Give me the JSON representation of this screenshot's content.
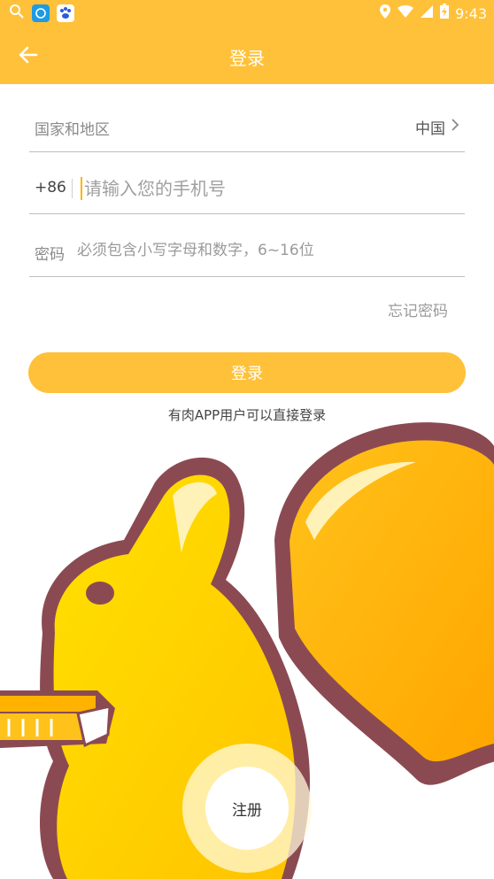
{
  "status_bar": {
    "time": "9:43"
  },
  "header": {
    "title": "登录",
    "back_icon": "arrow-left-icon"
  },
  "form": {
    "country_label": "国家和地区",
    "country_value": "中国",
    "phone_prefix": "+86",
    "phone_placeholder": "请输入您的手机号",
    "password_label": "密码",
    "password_placeholder": "必须包含小写字母和数字，6~16位"
  },
  "forgot_password": "忘记密码",
  "login_button": "登录",
  "hint": "有肉APP用户可以直接登录",
  "register_button": "注册",
  "colors": {
    "accent": "#FFC13A",
    "mascot_yellow": "#FFD200",
    "mascot_outline": "#8B4A52"
  }
}
